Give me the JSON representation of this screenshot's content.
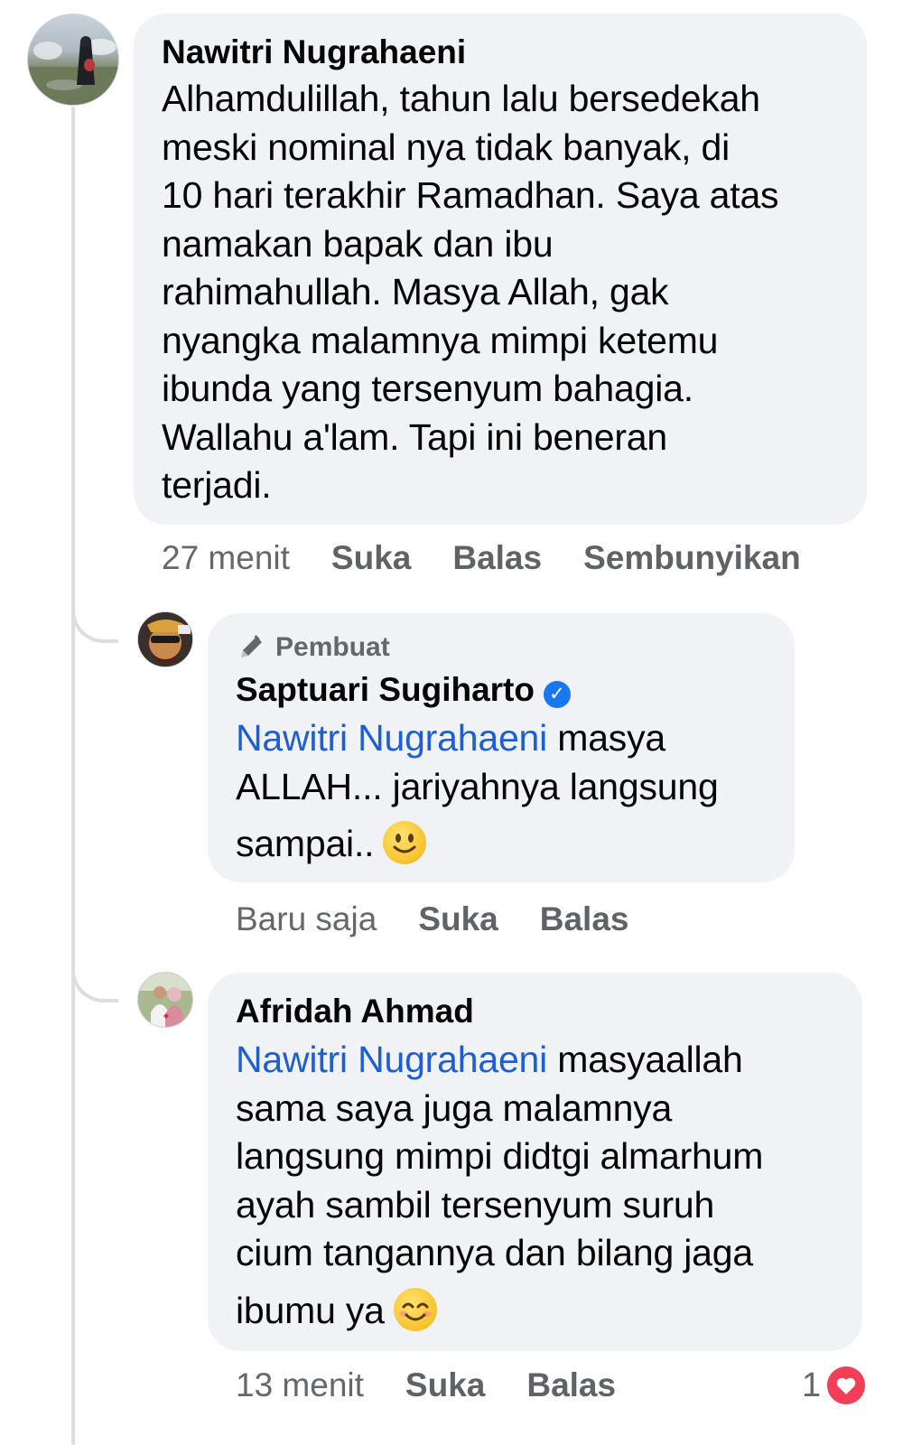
{
  "comments": [
    {
      "author": "Nawitri Nugrahaeni",
      "lines": [
        "Alhamdulillah, tahun lalu bersedekah",
        "meski nominal nya tidak banyak, di",
        "10 hari terakhir Ramadhan. Saya atas",
        "namakan bapak dan ibu",
        "rahimahullah. Masya Allah, gak",
        "nyangka malamnya mimpi ketemu",
        "ibunda yang tersenyum bahagia.",
        "Wallahu a'lam. Tapi ini beneran",
        "terjadi."
      ],
      "time": "27 menit",
      "like": "Suka",
      "reply": "Balas",
      "hide": "Sembunyikan"
    }
  ],
  "replies": [
    {
      "badge": "Pembuat",
      "author": "Saptuari Sugiharto",
      "verified": true,
      "mention": "Nawitri Nugrahaeni",
      "line1_rest": " masya",
      "line2": "ALLAH... jariyahnya langsung",
      "line3": "sampai..",
      "emoji": "slightly-smiling-face",
      "time": "Baru saja",
      "like": "Suka",
      "reply": "Balas"
    },
    {
      "author": "Afridah Ahmad",
      "mention": "Nawitri Nugrahaeni",
      "line1_rest": " masyaallah",
      "line2": "sama saya juga malamnya",
      "line3": "langsung mimpi didtgi almarhum",
      "line4": "ayah sambil tersenyum suruh",
      "line5": "cium tangannya dan bilang jaga",
      "line6": "ibumu ya",
      "emoji": "smiling-face-with-smiling-eyes",
      "time": "13 menit",
      "like": "Suka",
      "reply": "Balas",
      "reaction_count": "1",
      "reaction_type": "love"
    }
  ],
  "colors": {
    "bubble": "#f0f2f5",
    "mention": "#1d5fd3",
    "meta": "#65676b",
    "verified": "#1877f2",
    "love": "#f33e58"
  }
}
